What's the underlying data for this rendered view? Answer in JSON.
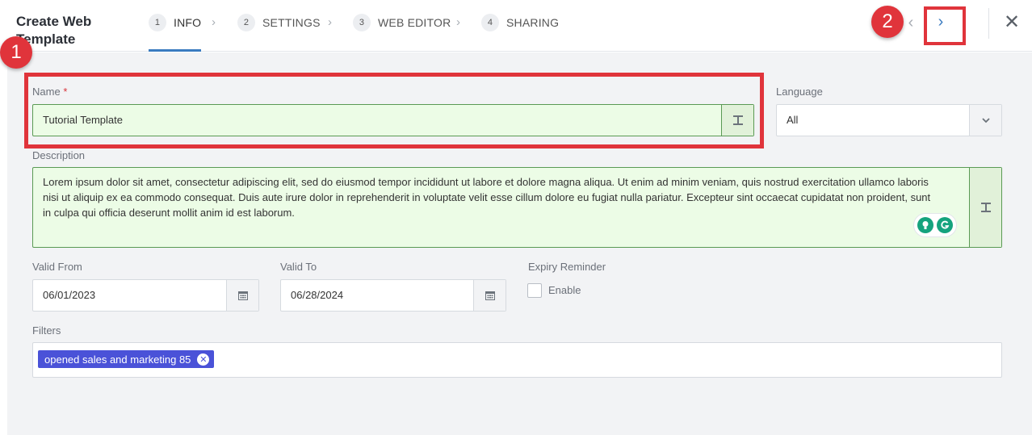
{
  "header": {
    "title": "Create Web Template",
    "steps": [
      {
        "num": "1",
        "label": "INFO"
      },
      {
        "num": "2",
        "label": "SETTINGS"
      },
      {
        "num": "3",
        "label": "WEB EDITOR"
      },
      {
        "num": "4",
        "label": "SHARING"
      }
    ],
    "chevron": "›",
    "prev_glyph": "‹",
    "next_glyph": "›",
    "close_glyph": "✕"
  },
  "annotations": {
    "badge1": "1",
    "badge2": "2"
  },
  "form": {
    "name": {
      "label": "Name",
      "required_mark": "*",
      "value": "Tutorial Template",
      "side_icon": "format-icon"
    },
    "language": {
      "label": "Language",
      "value": "All"
    },
    "description": {
      "label": "Description",
      "value": "Lorem ipsum dolor sit amet, consectetur adipiscing elit, sed do eiusmod tempor incididunt ut labore et dolore magna aliqua. Ut enim ad minim veniam, quis nostrud exercitation ullamco laboris nisi ut aliquip ex ea commodo consequat. Duis aute irure dolor in reprehenderit in voluptate velit esse cillum dolore eu fugiat nulla pariatur. Excepteur sint occaecat cupidatat non proident, sunt in culpa qui officia deserunt mollit anim id est laborum."
    },
    "valid_from": {
      "label": "Valid From",
      "value": "06/01/2023"
    },
    "valid_to": {
      "label": "Valid To",
      "value": "06/28/2024"
    },
    "expiry_reminder": {
      "label": "Expiry Reminder",
      "option": "Enable",
      "checked": false
    },
    "filters": {
      "label": "Filters",
      "chips": [
        "opened sales and marketing 85"
      ]
    }
  },
  "colors": {
    "accent": "#3a7bc0",
    "annotation_red": "#e0343b",
    "chip": "#4a52d8",
    "valid_field_bg": "#ecfce6"
  }
}
